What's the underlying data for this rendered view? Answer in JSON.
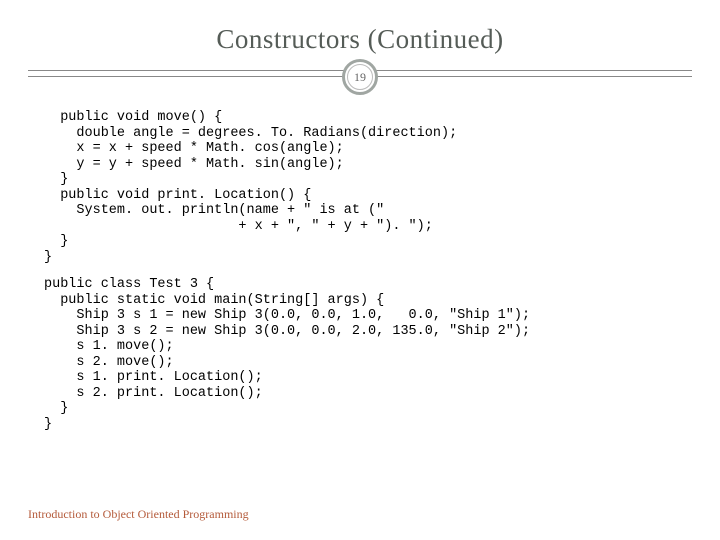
{
  "title": "Constructors (Continued)",
  "page_number": "19",
  "code1": "  public void move() {\n    double angle = degrees. To. Radians(direction);\n    x = x + speed * Math. cos(angle);\n    y = y + speed * Math. sin(angle);\n  }\n  public void print. Location() {\n    System. out. println(name + \" is at (\"\n                        + x + \", \" + y + \"). \");\n  }\n}",
  "code2": "public class Test 3 {\n  public static void main(String[] args) {\n    Ship 3 s 1 = new Ship 3(0.0, 0.0, 1.0,   0.0, \"Ship 1\");\n    Ship 3 s 2 = new Ship 3(0.0, 0.0, 2.0, 135.0, \"Ship 2\");\n    s 1. move();\n    s 2. move();\n    s 1. print. Location();\n    s 2. print. Location();\n  }\n}",
  "footer": "Introduction to Object Oriented Programming"
}
